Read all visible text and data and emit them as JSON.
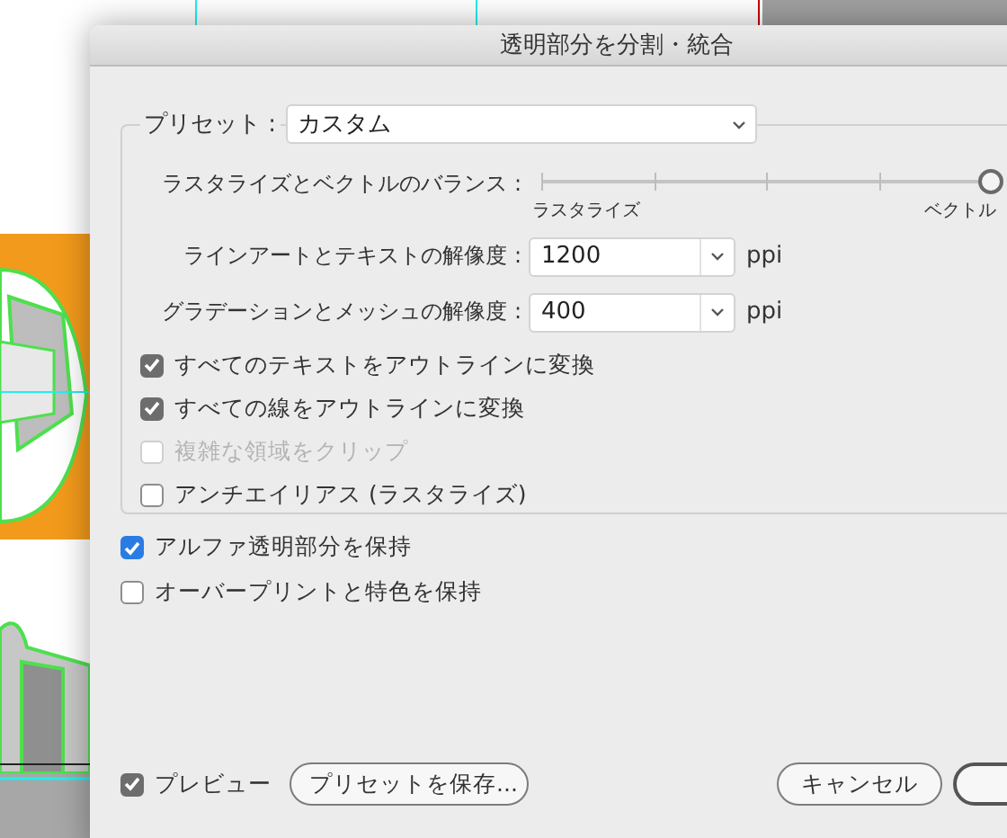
{
  "window": {
    "title": "透明部分を分割・統合"
  },
  "preset": {
    "label": "プリセット :",
    "value": "カスタム"
  },
  "balance": {
    "label": "ラスタライズとベクトルのバランス :",
    "min_label": "ラスタライズ",
    "max_label": "ベクトル",
    "level": 1
  },
  "resolutions": [
    {
      "label": "ラインアートとテキストの解像度 :",
      "value": "1200",
      "unit": "ppi"
    },
    {
      "label": "グラデーションとメッシュの解像度 :",
      "value": "400",
      "unit": "ppi"
    }
  ],
  "group_options": [
    {
      "label": "すべてのテキストをアウトラインに変換",
      "checked": true,
      "disabled": false
    },
    {
      "label": "すべての線をアウトラインに変換",
      "checked": true,
      "disabled": false
    },
    {
      "label": "複雑な領域をクリップ",
      "checked": false,
      "disabled": true
    },
    {
      "label": "アンチエイリアス (ラスタライズ)",
      "checked": false,
      "disabled": false
    }
  ],
  "options": [
    {
      "label": "アルファ透明部分を保持",
      "checked": true,
      "focused": true
    },
    {
      "label": "オーバープリントと特色を保持",
      "checked": false,
      "focused": false
    }
  ],
  "preview": {
    "label": "プレビュー",
    "checked": true
  },
  "save_preset_button": "プリセットを保存...",
  "buttons": [
    {
      "kind": "normal",
      "label": "キャンセル"
    },
    {
      "kind": "default"
    }
  ]
}
